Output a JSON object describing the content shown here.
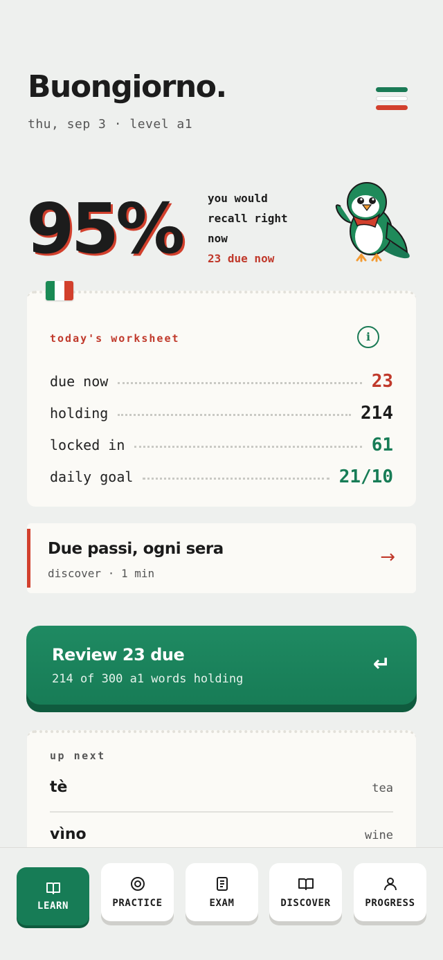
{
  "header": {
    "title": "Buongiorno.",
    "subtitle": "thu, sep 3 · level a1"
  },
  "recall": {
    "percent": "95%",
    "line1": "you would",
    "line2": "recall right",
    "line3": "now",
    "due": "23 due now"
  },
  "colors": {
    "green": "#177c56",
    "red": "#c0392b",
    "background": "#eef0ee",
    "card": "#fbfaf6"
  },
  "worksheet": {
    "label": "today's worksheet",
    "info_icon": "info-icon",
    "rows": [
      {
        "label": "due now",
        "value": "23",
        "color": "#c0392b"
      },
      {
        "label": "holding",
        "value": "214",
        "color": "#1b1b1b"
      },
      {
        "label": "locked in",
        "value": "61",
        "color": "#177c56"
      },
      {
        "label": "daily goal",
        "value": "21/10",
        "color": "#177c56"
      }
    ]
  },
  "discover": {
    "title": "Due passi, ogni sera",
    "meta": "discover · 1 min",
    "arrow": "→"
  },
  "review": {
    "title": "Review 23 due",
    "meta": "214 of 300 a1 words holding",
    "icon": "↵"
  },
  "upnext": {
    "label": "up next",
    "words": [
      {
        "it": "tè",
        "en": "tea"
      },
      {
        "it": "vìno",
        "en": "wine"
      }
    ]
  },
  "nav": {
    "items": [
      {
        "label": "LEARN",
        "icon": "book-open-icon",
        "active": true
      },
      {
        "label": "PRACTICE",
        "icon": "target-icon",
        "active": false
      },
      {
        "label": "EXAM",
        "icon": "document-icon",
        "active": false
      },
      {
        "label": "DISCOVER",
        "icon": "open-book-icon",
        "active": false
      },
      {
        "label": "PROGRESS",
        "icon": "user-icon",
        "active": false
      }
    ]
  }
}
